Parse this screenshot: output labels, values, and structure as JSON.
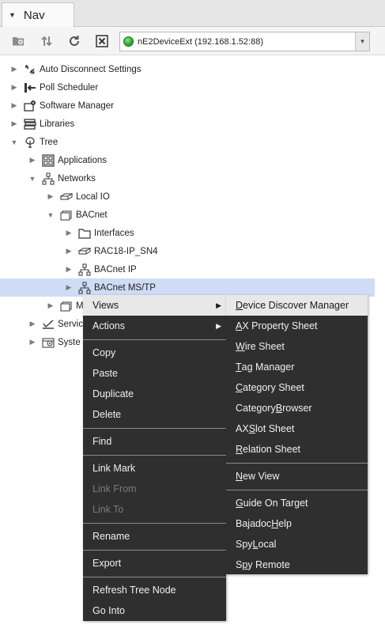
{
  "tab": {
    "title": "Nav"
  },
  "station": {
    "selected": "nE2DeviceExt (192.168.1.52:88)"
  },
  "toolbar_icons": [
    "new-folder-icon",
    "sort-icon",
    "refresh-icon",
    "close-icon"
  ],
  "tree": [
    {
      "label": "Auto Disconnect Settings",
      "icon": "disconnect-icon",
      "expanded": false
    },
    {
      "label": "Poll Scheduler",
      "icon": "poll-scheduler-icon",
      "expanded": false
    },
    {
      "label": "Software Manager",
      "icon": "software-manager-icon",
      "expanded": false
    },
    {
      "label": "Libraries",
      "icon": "libraries-icon",
      "expanded": false
    },
    {
      "label": "Tree",
      "icon": "tree-icon",
      "expanded": true
    },
    {
      "label": "Applications",
      "icon": "applications-icon",
      "expanded": false
    },
    {
      "label": "Networks",
      "icon": "network-icon",
      "expanded": true
    },
    {
      "label": "Local IO",
      "icon": "device-icon",
      "expanded": false
    },
    {
      "label": "BACnet",
      "icon": "folder-open-icon",
      "expanded": true
    },
    {
      "label": "Interfaces",
      "icon": "folder-icon",
      "expanded": false
    },
    {
      "label": "RAC18-IP_SN4",
      "icon": "device-icon",
      "expanded": false
    },
    {
      "label": "BACnet IP",
      "icon": "network-icon",
      "expanded": false
    },
    {
      "label": "BACnet MS/TP",
      "icon": "network-icon",
      "expanded": false,
      "selected": true
    },
    {
      "label": "M",
      "icon": "folder-open-icon",
      "expanded": false
    },
    {
      "label": "Servic",
      "icon": "services-icon",
      "expanded": false
    },
    {
      "label": "Syste",
      "icon": "system-icon",
      "expanded": false
    }
  ],
  "context_menu": {
    "items": [
      {
        "label": "Views",
        "submenu": true,
        "highlighted": true
      },
      {
        "label": "Actions",
        "submenu": true
      },
      {
        "label": "Copy"
      },
      {
        "label": "Paste"
      },
      {
        "label": "Duplicate"
      },
      {
        "label": "Delete"
      },
      {
        "label": "Find"
      },
      {
        "label": "Link Mark"
      },
      {
        "label": "Link From",
        "disabled": true
      },
      {
        "label": "Link To",
        "disabled": true
      },
      {
        "label": "Rename"
      },
      {
        "label": "Export"
      },
      {
        "label": "Refresh Tree Node"
      },
      {
        "label": "Go Into"
      }
    ]
  },
  "views_menu": {
    "items": [
      {
        "label": "Device Discover Manager",
        "mnemonic": "D",
        "highlighted": true
      },
      {
        "label": "AX Property Sheet",
        "mnemonic": "A"
      },
      {
        "label": "Wire Sheet",
        "mnemonic": "W"
      },
      {
        "label": "Tag Manager",
        "mnemonic": "T"
      },
      {
        "label": "Category Sheet",
        "mnemonic": "C"
      },
      {
        "label": "Category Browser",
        "mnemonic": "B"
      },
      {
        "label": "AX Slot Sheet",
        "mnemonic": "S"
      },
      {
        "label": "Relation Sheet",
        "mnemonic": "R"
      },
      {
        "label": "New View",
        "mnemonic": "N"
      },
      {
        "label": "Guide On Target",
        "mnemonic": "G"
      },
      {
        "label": "Bajadoc Help",
        "mnemonic": "H"
      },
      {
        "label": "Spy Local",
        "mnemonic": "L"
      },
      {
        "label": "Spy Remote",
        "mnemonic": "p"
      }
    ]
  },
  "colors": {
    "selection": "#cfdcf5",
    "menu_bg": "#2f2f2f",
    "menu_highlight": "#e8e8e8",
    "status_ok": "#28a42a"
  }
}
